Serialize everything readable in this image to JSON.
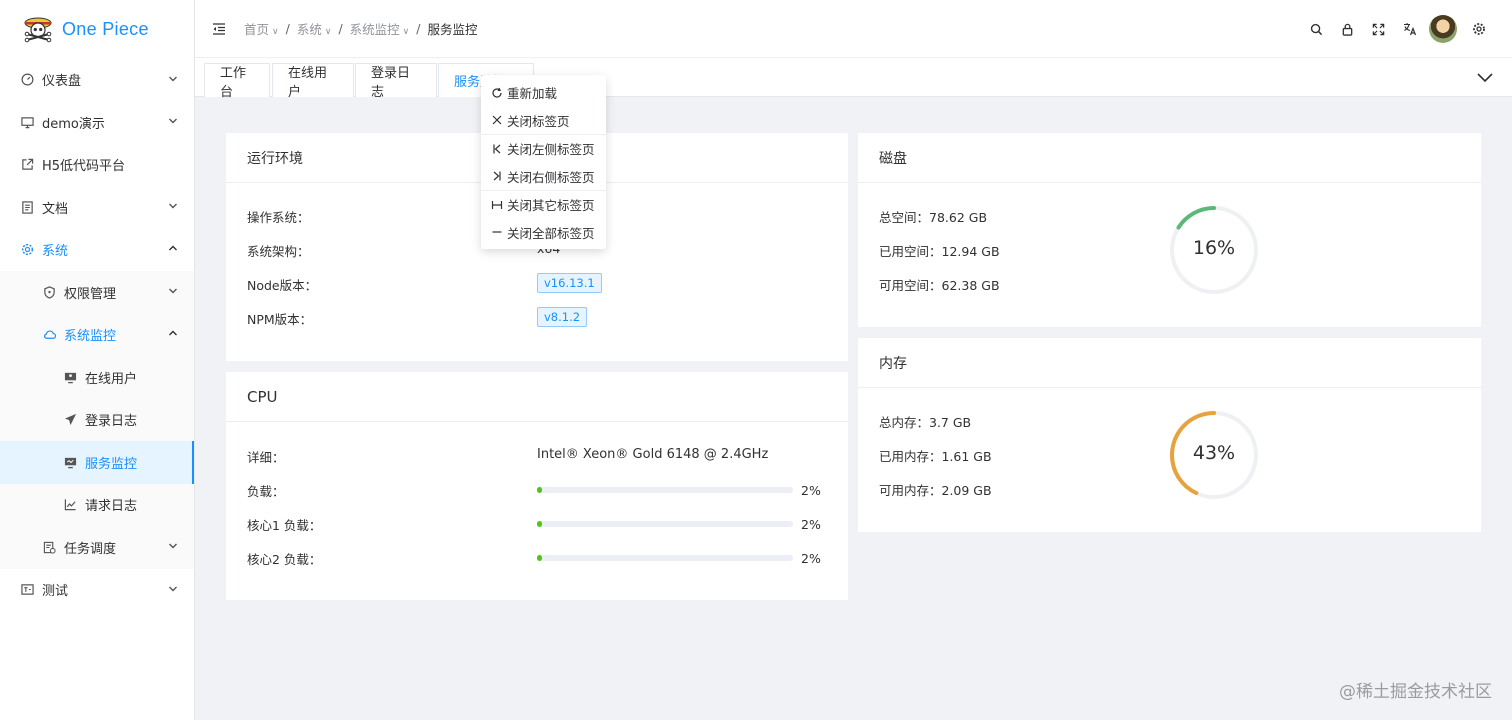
{
  "app": {
    "title": "One Piece"
  },
  "sidebar": {
    "items": [
      {
        "label": "仪表盘",
        "icon": "dashboard-icon"
      },
      {
        "label": "demo演示",
        "icon": "monitor-icon"
      },
      {
        "label": "H5低代码平台",
        "icon": "external-link-icon"
      },
      {
        "label": "文档",
        "icon": "document-icon"
      },
      {
        "label": "系统",
        "icon": "gear-icon"
      },
      {
        "label": "权限管理",
        "icon": "shield-icon"
      },
      {
        "label": "系统监控",
        "icon": "cloud-icon"
      },
      {
        "label": "在线用户",
        "icon": "user-monitor-icon"
      },
      {
        "label": "登录日志",
        "icon": "paper-plane-icon"
      },
      {
        "label": "服务监控",
        "icon": "server-monitor-icon"
      },
      {
        "label": "请求日志",
        "icon": "line-chart-icon"
      },
      {
        "label": "任务调度",
        "icon": "schedule-icon"
      },
      {
        "label": "测试",
        "icon": "test-icon"
      }
    ]
  },
  "breadcrumb": {
    "items": [
      "首页",
      "系统",
      "系统监控",
      "服务监控"
    ]
  },
  "tabs": [
    {
      "label": "工作台"
    },
    {
      "label": "在线用户"
    },
    {
      "label": "登录日志"
    },
    {
      "label": "服务监控"
    }
  ],
  "context_menu": {
    "items": [
      {
        "label": "重新加载",
        "icon": "reload-icon"
      },
      {
        "label": "关闭标签页",
        "icon": "close-icon"
      },
      {
        "label": "关闭左侧标签页",
        "icon": "close-left-icon"
      },
      {
        "label": "关闭右侧标签页",
        "icon": "close-right-icon"
      },
      {
        "label": "关闭其它标签页",
        "icon": "close-other-icon"
      },
      {
        "label": "关闭全部标签页",
        "icon": "close-all-icon"
      }
    ]
  },
  "runtime": {
    "title": "运行环境",
    "rows": [
      {
        "label": "操作系统：",
        "value": ""
      },
      {
        "label": "系统架构：",
        "value": "x64"
      },
      {
        "label": "Node版本：",
        "value": "v16.13.1"
      },
      {
        "label": "NPM版本：",
        "value": "v8.1.2"
      }
    ]
  },
  "cpu": {
    "title": "CPU",
    "detail_label": "详细：",
    "detail_value": "Intel® Xeon® Gold 6148 @ 2.4GHz",
    "loads": [
      {
        "label": "负载：",
        "percent": 2,
        "text": "2%"
      },
      {
        "label": "核心1 负载：",
        "percent": 2,
        "text": "2%"
      },
      {
        "label": "核心2 负载：",
        "percent": 2,
        "text": "2%"
      }
    ]
  },
  "disk": {
    "title": "磁盘",
    "rows": [
      "总空间：78.62 GB",
      "已用空间：12.94 GB",
      "可用空间：62.38 GB"
    ],
    "percent": 16,
    "percent_text": "16%",
    "color": "#5cb87a"
  },
  "memory": {
    "title": "内存",
    "rows": [
      "总内存：3.7 GB",
      "已用内存：1.61 GB",
      "可用内存：2.09 GB"
    ],
    "percent": 43,
    "percent_text": "43%",
    "color": "#e6a23c"
  },
  "watermark": "@稀土掘金技术社区",
  "colors": {
    "accent": "#1890ff",
    "progress": "#52c41a",
    "background": "#f0f2f5"
  }
}
